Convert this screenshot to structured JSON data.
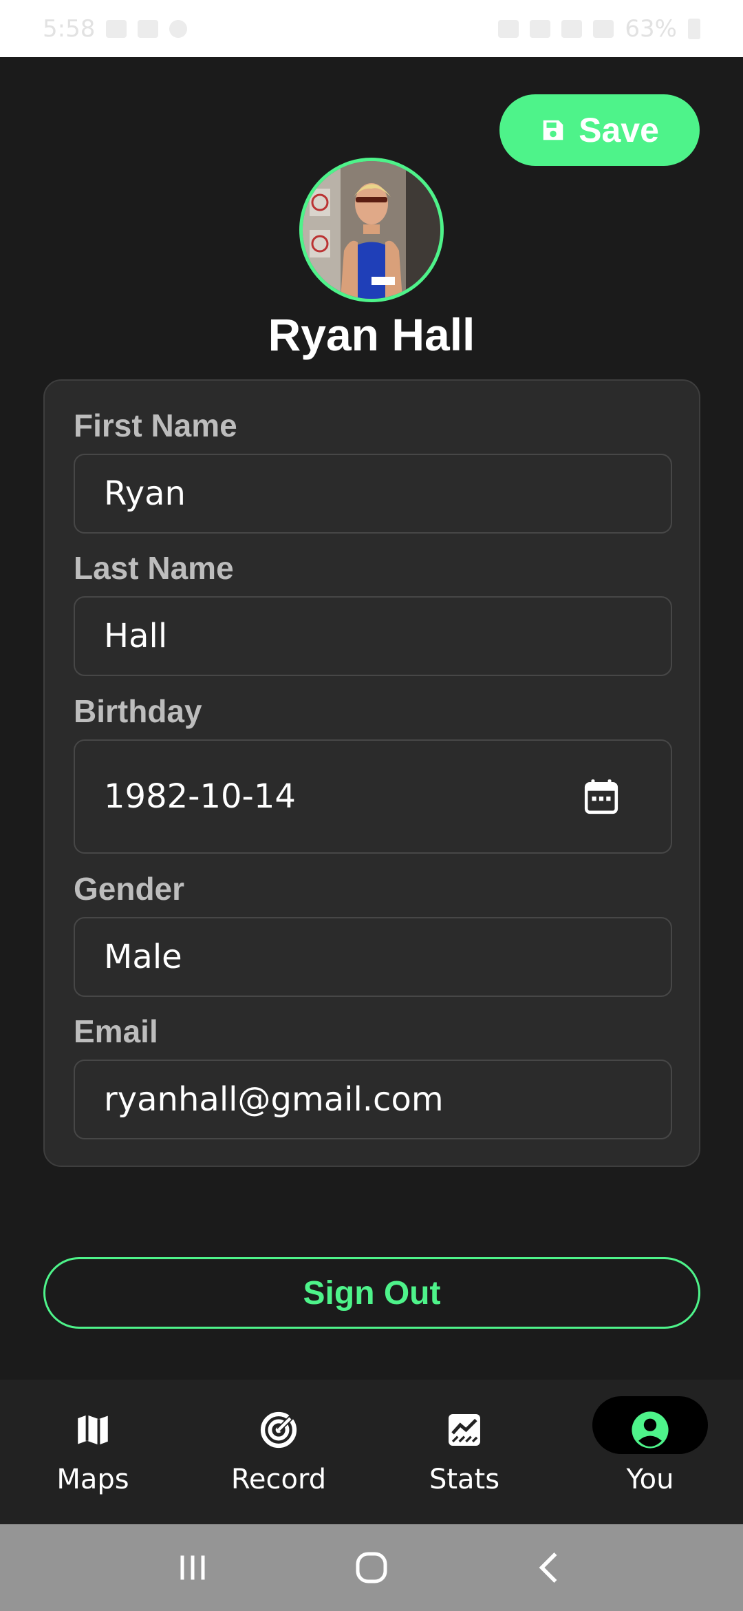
{
  "status_bar": {
    "time": "5:58",
    "battery": "63%"
  },
  "header": {
    "save_label": "Save"
  },
  "profile": {
    "name": "Ryan Hall"
  },
  "form": {
    "first_name": {
      "label": "First Name",
      "value": "Ryan"
    },
    "last_name": {
      "label": "Last Name",
      "value": "Hall"
    },
    "birthday": {
      "label": "Birthday",
      "value": "1982-10-14"
    },
    "gender": {
      "label": "Gender",
      "value": "Male"
    },
    "email": {
      "label": "Email",
      "value": "ryanhall@gmail.com"
    }
  },
  "signout_label": "Sign Out",
  "nav": {
    "items": [
      {
        "label": "Maps",
        "icon": "map-icon",
        "active": false
      },
      {
        "label": "Record",
        "icon": "record-icon",
        "active": false
      },
      {
        "label": "Stats",
        "icon": "stats-icon",
        "active": false
      },
      {
        "label": "You",
        "icon": "user-icon",
        "active": true
      }
    ]
  },
  "colors": {
    "accent": "#4ef38a",
    "background": "#1b1b1b",
    "card": "#2b2b2b"
  }
}
